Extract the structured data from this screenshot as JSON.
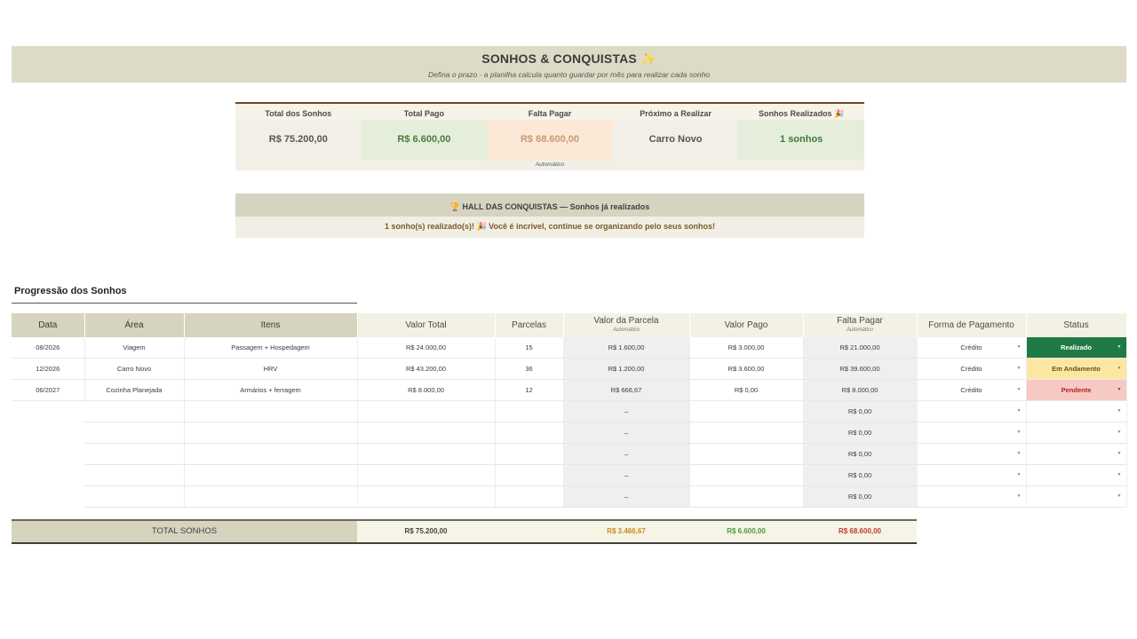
{
  "header": {
    "title": "SONHOS & CONQUISTAS",
    "title_emoji": "✨",
    "subtitle": "Defina o prazo · a planilha calcula quanto guardar por mês para realizar cada sonho"
  },
  "summary": {
    "headers": [
      "Total dos Sonhos",
      "Total Pago",
      "Falta Pagar",
      "Próximo a Realizar",
      "Sonhos Realizados 🎉"
    ],
    "values": [
      "R$ 75.200,00",
      "R$ 6.600,00",
      "R$ 68.600,00",
      "Carro Novo",
      "1 sonhos"
    ],
    "note": "Automático"
  },
  "hall": {
    "title": "🏆  HALL DAS CONQUISTAS — Sonhos já realizados",
    "message": "1 sonho(s) realizado(s)! 🎉 Você é incrível, continue se organizando pelo seus sonhos!"
  },
  "progress": {
    "section_title": "Progressão dos Sonhos",
    "columns": {
      "data": "Data",
      "area": "Área",
      "itens": "Itens",
      "valor_total": "Valor Total",
      "parcelas": "Parcelas",
      "valor_parcela": "Valor da Parcela",
      "valor_parcela_sub": "Automático",
      "valor_pago": "Valor Pago",
      "falta_pagar": "Falta Pagar",
      "falta_pagar_sub": "Automático",
      "forma_pagamento": "Forma de Pagamento",
      "status": "Status"
    },
    "rows": [
      {
        "data": "08/2026",
        "area": "Viagem",
        "itens": "Passagem + Hospedagem",
        "valor_total": "R$ 24.000,00",
        "parcelas": "15",
        "valor_parcela": "R$ 1.600,00",
        "valor_pago": "R$ 3.000,00",
        "falta_pagar": "R$ 21.000,00",
        "forma": "Crédito",
        "status": "Realizado"
      },
      {
        "data": "12/2026",
        "area": "Carro Novo",
        "itens": "HRV",
        "valor_total": "R$ 43.200,00",
        "parcelas": "36",
        "valor_parcela": "R$ 1.200,00",
        "valor_pago": "R$ 3.600,00",
        "falta_pagar": "R$ 39.600,00",
        "forma": "Crédito",
        "status": "Em Andamento"
      },
      {
        "data": "06/2027",
        "area": "Cozinha Planejada",
        "itens": "Armários + ferragem",
        "valor_total": "R$ 8.000,00",
        "parcelas": "12",
        "valor_parcela": "R$ 666,67",
        "valor_pago": "R$ 0,00",
        "falta_pagar": "R$ 8.000,00",
        "forma": "Crédito",
        "status": "Pendente"
      }
    ],
    "empty_parcela": "–",
    "empty_falta": "R$ 0,00",
    "dropdown_arrow": "▼"
  },
  "totals": {
    "label": "TOTAL SONHOS",
    "valor_total": "R$ 75.200,00",
    "valor_parcela": "R$ 3.466,67",
    "valor_pago": "R$ 6.600,00",
    "falta_pagar": "R$ 68.600,00"
  },
  "colors": {
    "banner": "#dddbc7",
    "status_realizado": "#1f7a45",
    "status_andamento": "#fbe7a2",
    "status_pendente": "#f7c9c4",
    "total_parcela": "#c98a1a",
    "total_pago": "#4a9a3a",
    "total_falta": "#c0392b"
  }
}
